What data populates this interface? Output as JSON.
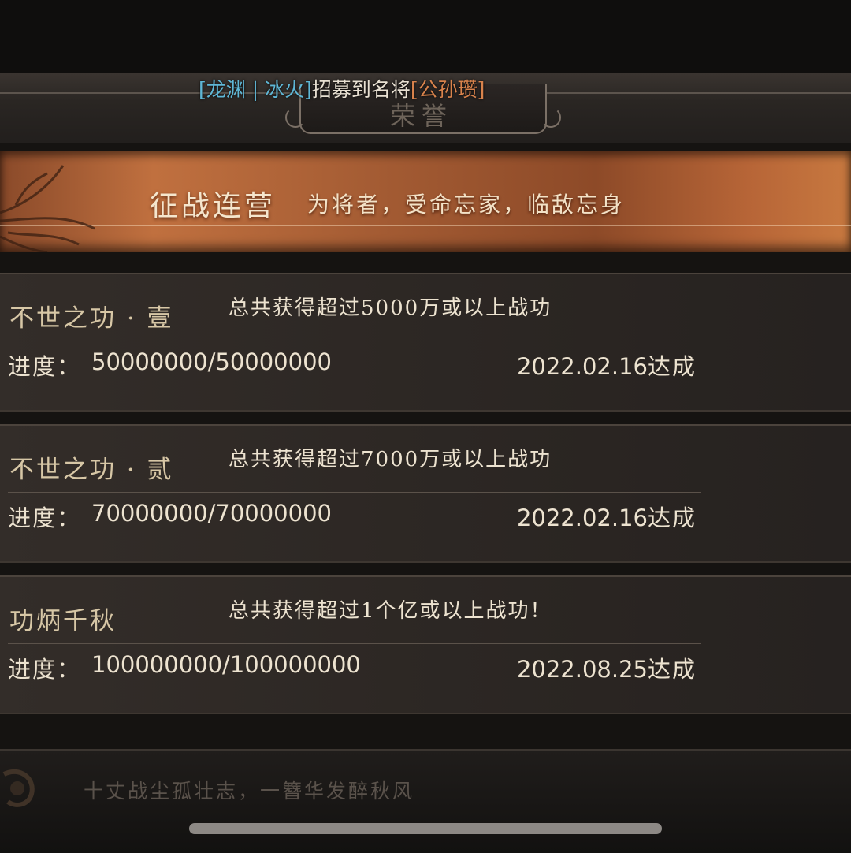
{
  "header": {
    "title": "荣誉",
    "broadcast": {
      "player": "[龙渊 | 冰火]",
      "action": "招募到名将",
      "general": "[公孙瓒]"
    }
  },
  "banner": {
    "title": "征战连营",
    "subtitle": "为将者，受命忘家，临敌忘身"
  },
  "achievements": [
    {
      "name": "不世之功 · 壹",
      "description": "总共获得超过5000万或以上战功",
      "progress_label": "进度：",
      "progress": "50000000/50000000",
      "date": "2022.02.16",
      "date_suffix": "达成"
    },
    {
      "name": "不世之功 · 贰",
      "description": "总共获得超过7000万或以上战功",
      "progress_label": "进度：",
      "progress": "70000000/70000000",
      "date": "2022.02.16",
      "date_suffix": "达成"
    },
    {
      "name": "功炳千秋",
      "description": "总共获得超过1个亿或以上战功！",
      "progress_label": "进度：",
      "progress": "100000000/100000000",
      "date": "2022.08.25",
      "date_suffix": "达成"
    }
  ],
  "footer": {
    "quote": "十丈战尘孤壮志，一簪华发醉秋风"
  },
  "colors": {
    "banner": "#b5643a",
    "player_name": "#5fb7d6",
    "general_name": "#d9834c",
    "achievement_name": "#d7c7a6"
  }
}
